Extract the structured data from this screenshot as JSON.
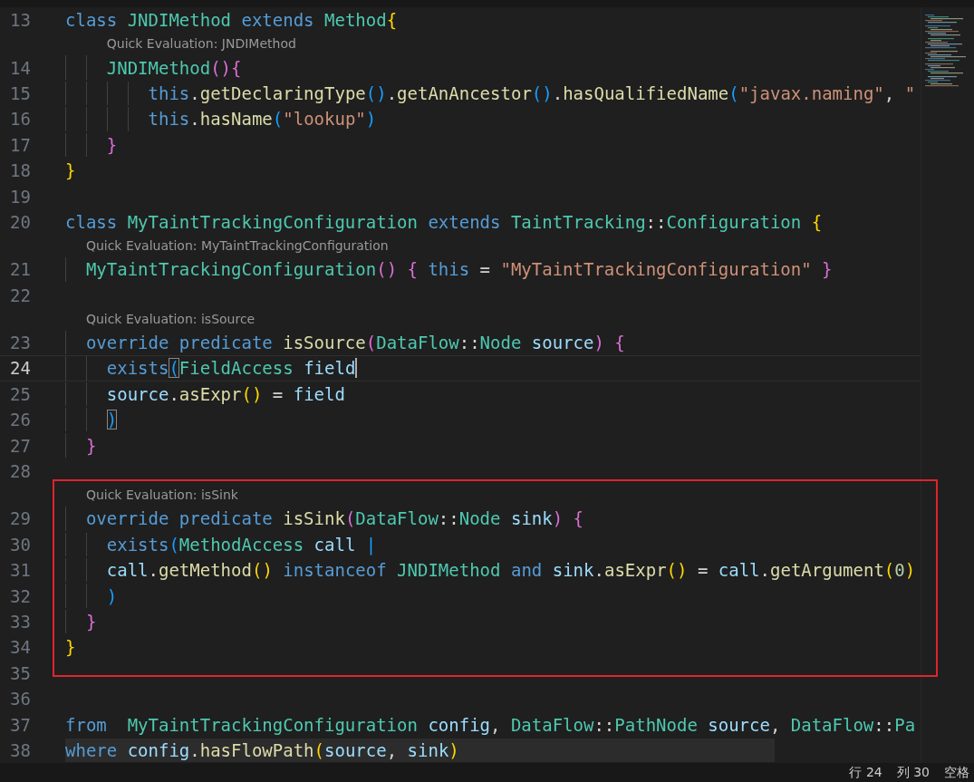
{
  "editor": {
    "lines": [
      {
        "kind": "code",
        "number": "13",
        "boxed": false,
        "current": false,
        "highlighted": false,
        "cursor": false,
        "tokens": [
          {
            "kind": "kw",
            "text": "class "
          },
          {
            "kind": "type",
            "text": "JNDIMethod "
          },
          {
            "kind": "kw",
            "text": "extends "
          },
          {
            "kind": "type",
            "text": "Method"
          },
          {
            "kind": "b1",
            "text": "{"
          }
        ]
      },
      {
        "kind": "lens",
        "text": "Quick Evaluation: JNDIMethod",
        "boxed": false
      },
      {
        "kind": "code",
        "number": "14",
        "boxed": false,
        "current": false,
        "highlighted": false,
        "cursor": false,
        "tokens": [
          {
            "kind": "type",
            "text": "    JNDIMethod"
          },
          {
            "kind": "b2",
            "text": "(){"
          }
        ]
      },
      {
        "kind": "code",
        "number": "15",
        "boxed": false,
        "current": false,
        "highlighted": false,
        "cursor": false,
        "tokens": [
          {
            "kind": "kw",
            "text": "        this"
          },
          {
            "kind": "p",
            "text": "."
          },
          {
            "kind": "fn",
            "text": "getDeclaringType"
          },
          {
            "kind": "b3",
            "text": "()"
          },
          {
            "kind": "p",
            "text": "."
          },
          {
            "kind": "fn",
            "text": "getAnAncestor"
          },
          {
            "kind": "b3",
            "text": "()"
          },
          {
            "kind": "p",
            "text": "."
          },
          {
            "kind": "fn",
            "text": "hasQualifiedName"
          },
          {
            "kind": "b3",
            "text": "("
          },
          {
            "kind": "str",
            "text": "\"javax.naming\""
          },
          {
            "kind": "p",
            "text": ", "
          },
          {
            "kind": "str",
            "text": "\""
          }
        ]
      },
      {
        "kind": "code",
        "number": "16",
        "boxed": false,
        "current": false,
        "highlighted": false,
        "cursor": false,
        "tokens": [
          {
            "kind": "kw",
            "text": "        this"
          },
          {
            "kind": "p",
            "text": "."
          },
          {
            "kind": "fn",
            "text": "hasName"
          },
          {
            "kind": "b3",
            "text": "("
          },
          {
            "kind": "str",
            "text": "\"lookup\""
          },
          {
            "kind": "b3",
            "text": ")"
          }
        ]
      },
      {
        "kind": "code",
        "number": "17",
        "boxed": false,
        "current": false,
        "highlighted": false,
        "cursor": false,
        "tokens": [
          {
            "kind": "b2",
            "text": "    }"
          }
        ]
      },
      {
        "kind": "code",
        "number": "18",
        "boxed": false,
        "current": false,
        "highlighted": false,
        "cursor": false,
        "tokens": [
          {
            "kind": "b1",
            "text": "}"
          }
        ]
      },
      {
        "kind": "code",
        "number": "19",
        "boxed": false,
        "current": false,
        "highlighted": false,
        "cursor": false
      },
      {
        "kind": "code",
        "number": "20",
        "boxed": false,
        "current": false,
        "highlighted": false,
        "cursor": false,
        "tokens": [
          {
            "kind": "kw",
            "text": "class "
          },
          {
            "kind": "type",
            "text": "MyTaintTrackingConfiguration "
          },
          {
            "kind": "kw",
            "text": "extends "
          },
          {
            "kind": "type",
            "text": "TaintTracking"
          },
          {
            "kind": "p",
            "text": "::"
          },
          {
            "kind": "type",
            "text": "Configuration "
          },
          {
            "kind": "b1",
            "text": "{"
          }
        ]
      },
      {
        "kind": "lens",
        "text": "Quick Evaluation: MyTaintTrackingConfiguration",
        "boxed": false
      },
      {
        "kind": "code",
        "number": "21",
        "boxed": false,
        "current": false,
        "highlighted": false,
        "cursor": false,
        "tokens": [
          {
            "kind": "type",
            "text": "  MyTaintTrackingConfiguration"
          },
          {
            "kind": "b2",
            "text": "() { "
          },
          {
            "kind": "kw",
            "text": "this "
          },
          {
            "kind": "p",
            "text": "= "
          },
          {
            "kind": "str",
            "text": "\"MyTaintTrackingConfiguration\" "
          },
          {
            "kind": "b2",
            "text": "}"
          }
        ]
      },
      {
        "kind": "code",
        "number": "22",
        "boxed": false,
        "current": false,
        "highlighted": false,
        "cursor": false
      },
      {
        "kind": "lens",
        "text": "Quick Evaluation: isSource",
        "boxed": false
      },
      {
        "kind": "code",
        "number": "23",
        "boxed": false,
        "current": false,
        "highlighted": false,
        "cursor": false,
        "tokens": [
          {
            "kind": "kw",
            "text": "  override predicate "
          },
          {
            "kind": "fn",
            "text": "isSource"
          },
          {
            "kind": "b2",
            "text": "("
          },
          {
            "kind": "type",
            "text": "DataFlow"
          },
          {
            "kind": "p",
            "text": "::"
          },
          {
            "kind": "type",
            "text": "Node "
          },
          {
            "kind": "var",
            "text": "source"
          },
          {
            "kind": "b2",
            "text": ") {"
          }
        ]
      },
      {
        "kind": "code",
        "number": "24",
        "boxed": false,
        "current": true,
        "highlighted": false,
        "cursor": true,
        "tokens": [
          {
            "kind": "kw",
            "text": "    exists"
          },
          {
            "kind": "match",
            "text": "("
          },
          {
            "kind": "type",
            "text": "FieldAccess "
          },
          {
            "kind": "var",
            "text": "field"
          }
        ]
      },
      {
        "kind": "code",
        "number": "25",
        "boxed": false,
        "current": false,
        "highlighted": false,
        "cursor": false,
        "tokens": [
          {
            "kind": "var",
            "text": "    source"
          },
          {
            "kind": "p",
            "text": "."
          },
          {
            "kind": "fn",
            "text": "asExpr"
          },
          {
            "kind": "b1",
            "text": "()"
          },
          {
            "kind": "p",
            "text": " = "
          },
          {
            "kind": "var",
            "text": "field"
          }
        ]
      },
      {
        "kind": "code",
        "number": "26",
        "boxed": false,
        "current": false,
        "highlighted": false,
        "cursor": false,
        "tokens": [
          {
            "kind": "match",
            "text": "    )"
          }
        ]
      },
      {
        "kind": "code",
        "number": "27",
        "boxed": false,
        "current": false,
        "highlighted": false,
        "cursor": false,
        "tokens": [
          {
            "kind": "b2",
            "text": "  }"
          }
        ]
      },
      {
        "kind": "code",
        "number": "28",
        "boxed": false,
        "current": false,
        "highlighted": false,
        "cursor": false
      },
      {
        "kind": "lens",
        "text": "Quick Evaluation: isSink",
        "boxed": true
      },
      {
        "kind": "code",
        "number": "29",
        "boxed": true,
        "current": false,
        "highlighted": false,
        "cursor": false,
        "tokens": [
          {
            "kind": "kw",
            "text": "  override predicate "
          },
          {
            "kind": "fn",
            "text": "isSink"
          },
          {
            "kind": "b2",
            "text": "("
          },
          {
            "kind": "type",
            "text": "DataFlow"
          },
          {
            "kind": "p",
            "text": "::"
          },
          {
            "kind": "type",
            "text": "Node "
          },
          {
            "kind": "var",
            "text": "sink"
          },
          {
            "kind": "b2",
            "text": ") {"
          }
        ]
      },
      {
        "kind": "code",
        "number": "30",
        "boxed": true,
        "current": false,
        "highlighted": false,
        "cursor": false,
        "tokens": [
          {
            "kind": "kw",
            "text": "    exists"
          },
          {
            "kind": "b3",
            "text": "("
          },
          {
            "kind": "type",
            "text": "MethodAccess "
          },
          {
            "kind": "var",
            "text": "call "
          },
          {
            "kind": "b3",
            "text": "|"
          }
        ]
      },
      {
        "kind": "code",
        "number": "31",
        "boxed": true,
        "current": false,
        "highlighted": false,
        "cursor": false,
        "tokens": [
          {
            "kind": "var",
            "text": "    call"
          },
          {
            "kind": "p",
            "text": "."
          },
          {
            "kind": "fn",
            "text": "getMethod"
          },
          {
            "kind": "b1",
            "text": "() "
          },
          {
            "kind": "kw",
            "text": "instanceof "
          },
          {
            "kind": "type",
            "text": "JNDIMethod "
          },
          {
            "kind": "kw",
            "text": "and "
          },
          {
            "kind": "var",
            "text": "sink"
          },
          {
            "kind": "p",
            "text": "."
          },
          {
            "kind": "fn",
            "text": "asExpr"
          },
          {
            "kind": "b1",
            "text": "()"
          },
          {
            "kind": "p",
            "text": " = "
          },
          {
            "kind": "var",
            "text": "call"
          },
          {
            "kind": "p",
            "text": "."
          },
          {
            "kind": "fn",
            "text": "getArgument"
          },
          {
            "kind": "b1",
            "text": "("
          },
          {
            "kind": "num",
            "text": "0"
          },
          {
            "kind": "b1",
            "text": ")"
          }
        ]
      },
      {
        "kind": "code",
        "number": "32",
        "boxed": true,
        "current": false,
        "highlighted": false,
        "cursor": false,
        "tokens": [
          {
            "kind": "b3",
            "text": "    )"
          }
        ]
      },
      {
        "kind": "code",
        "number": "33",
        "boxed": true,
        "current": false,
        "highlighted": false,
        "cursor": false,
        "tokens": [
          {
            "kind": "b2",
            "text": "  }"
          }
        ]
      },
      {
        "kind": "code",
        "number": "34",
        "boxed": true,
        "current": false,
        "highlighted": false,
        "cursor": false,
        "tokens": [
          {
            "kind": "b1",
            "text": "}"
          }
        ]
      },
      {
        "kind": "code",
        "number": "35",
        "boxed": true,
        "current": false,
        "highlighted": false,
        "cursor": false
      },
      {
        "kind": "code",
        "number": "36",
        "boxed": false,
        "current": false,
        "highlighted": false,
        "cursor": false
      },
      {
        "kind": "code",
        "number": "37",
        "boxed": false,
        "current": false,
        "highlighted": false,
        "cursor": false,
        "tokens": [
          {
            "kind": "kw",
            "text": "from  "
          },
          {
            "kind": "type",
            "text": "MyTaintTrackingConfiguration "
          },
          {
            "kind": "var",
            "text": "config"
          },
          {
            "kind": "p",
            "text": ", "
          },
          {
            "kind": "type",
            "text": "DataFlow"
          },
          {
            "kind": "p",
            "text": "::"
          },
          {
            "kind": "type",
            "text": "PathNode "
          },
          {
            "kind": "var",
            "text": "source"
          },
          {
            "kind": "p",
            "text": ", "
          },
          {
            "kind": "type",
            "text": "DataFlow"
          },
          {
            "kind": "p",
            "text": "::"
          },
          {
            "kind": "type",
            "text": "Pa"
          }
        ]
      },
      {
        "kind": "code",
        "number": "38",
        "boxed": false,
        "current": false,
        "highlighted": true,
        "cursor": false,
        "tokens": [
          {
            "kind": "kw",
            "text": "where "
          },
          {
            "kind": "var",
            "text": "config"
          },
          {
            "kind": "p",
            "text": "."
          },
          {
            "kind": "fn",
            "text": "hasFlowPath"
          },
          {
            "kind": "b1",
            "text": "("
          },
          {
            "kind": "var",
            "text": "source"
          },
          {
            "kind": "p",
            "text": ", "
          },
          {
            "kind": "var",
            "text": "sink"
          },
          {
            "kind": "b1",
            "text": ")"
          }
        ]
      }
    ]
  },
  "status_bar": {
    "items": [
      "行 24",
      "列 30",
      "空格"
    ]
  }
}
